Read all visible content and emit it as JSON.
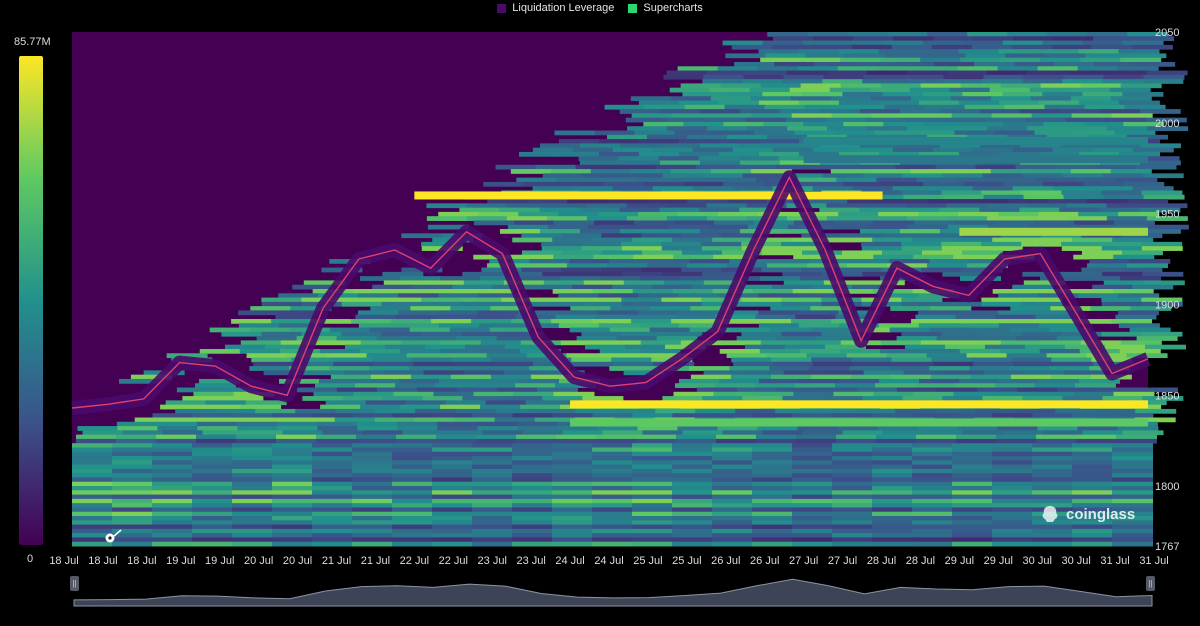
{
  "legend": {
    "items": [
      {
        "label": "Liquidation Leverage",
        "color": "#4a0a6b"
      },
      {
        "label": "Supercharts",
        "color": "#2ed573"
      }
    ]
  },
  "colorbar": {
    "max_label": "85.77M",
    "min_label": "0",
    "colors": [
      "#440154",
      "#3b528b",
      "#21918c",
      "#5ec962",
      "#fde725"
    ]
  },
  "brand": {
    "name": "coinglass"
  },
  "chart_data": {
    "type": "heatmap",
    "title": "",
    "ylim": [
      1767,
      2050
    ],
    "y_ticks": [
      2050,
      2000,
      1950,
      1900,
      1850,
      1800,
      1767
    ],
    "x_tick_labels": [
      "18 Jul",
      "18 Jul",
      "18 Jul",
      "19 Jul",
      "19 Jul",
      "20 Jul",
      "20 Jul",
      "21 Jul",
      "21 Jul",
      "22 Jul",
      "22 Jul",
      "23 Jul",
      "23 Jul",
      "24 Jul",
      "24 Jul",
      "25 Jul",
      "25 Jul",
      "26 Jul",
      "26 Jul",
      "27 Jul",
      "27 Jul",
      "28 Jul",
      "28 Jul",
      "29 Jul",
      "29 Jul",
      "30 Jul",
      "30 Jul",
      "31 Jul",
      "31 Jul"
    ],
    "color_scale": {
      "min": 0,
      "max": 85770000,
      "colormap": "viridis"
    },
    "price_series": [
      {
        "x": 0,
        "y": 1843
      },
      {
        "x": 1,
        "y": 1845
      },
      {
        "x": 2,
        "y": 1848
      },
      {
        "x": 3,
        "y": 1868
      },
      {
        "x": 4,
        "y": 1866
      },
      {
        "x": 5,
        "y": 1855
      },
      {
        "x": 6,
        "y": 1850
      },
      {
        "x": 7,
        "y": 1898
      },
      {
        "x": 8,
        "y": 1925
      },
      {
        "x": 9,
        "y": 1930
      },
      {
        "x": 10,
        "y": 1920
      },
      {
        "x": 11,
        "y": 1940
      },
      {
        "x": 12,
        "y": 1928
      },
      {
        "x": 13,
        "y": 1882
      },
      {
        "x": 14,
        "y": 1860
      },
      {
        "x": 15,
        "y": 1855
      },
      {
        "x": 16,
        "y": 1857
      },
      {
        "x": 17,
        "y": 1870
      },
      {
        "x": 18,
        "y": 1885
      },
      {
        "x": 19,
        "y": 1930
      },
      {
        "x": 20,
        "y": 1970
      },
      {
        "x": 21,
        "y": 1930
      },
      {
        "x": 22,
        "y": 1880
      },
      {
        "x": 23,
        "y": 1920
      },
      {
        "x": 24,
        "y": 1910
      },
      {
        "x": 25,
        "y": 1905
      },
      {
        "x": 26,
        "y": 1925
      },
      {
        "x": 27,
        "y": 1928
      },
      {
        "x": 28,
        "y": 1895
      },
      {
        "x": 29,
        "y": 1862
      },
      {
        "x": 30,
        "y": 1870
      }
    ],
    "liquidation_bands": [
      {
        "price": 1960,
        "intensity": 1.0,
        "from_label": "22 Jul",
        "to_label": "27 Jul"
      },
      {
        "price": 1940,
        "intensity": 0.85,
        "from_label": "29 Jul",
        "to_label": "31 Jul"
      },
      {
        "price": 1845,
        "intensity": 1.0,
        "from_label": "24 Jul",
        "to_label": "31 Jul"
      },
      {
        "price": 1835,
        "intensity": 0.75,
        "from_label": "24 Jul",
        "to_label": "31 Jul"
      },
      {
        "price": 1990,
        "intensity": 0.45,
        "from_label": "27 Jul",
        "to_label": "31 Jul"
      },
      {
        "price": 1980,
        "intensity": 0.4,
        "from_label": "27 Jul",
        "to_label": "31 Jul"
      }
    ]
  }
}
